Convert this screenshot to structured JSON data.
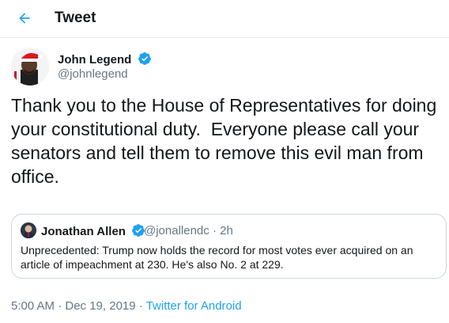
{
  "header": {
    "title": "Tweet",
    "accent_color": "#1da1f2"
  },
  "tweet": {
    "author_name": "John Legend",
    "author_handle": "@johnlegend",
    "verified": true,
    "text": "Thank you to the House of Representatives for doing\nyour constitutional duty.  Everyone please call your\nsenators and tell them to remove this evil man from\noffice.",
    "timestamp": "5:00 AM · Dec 19, 2019",
    "separator": "·",
    "source": "Twitter for Android"
  },
  "quote": {
    "author_name": "Jonathan Allen",
    "verified": true,
    "author_handle": "@jonallendc",
    "separator": "·",
    "time": "2h",
    "text": "Unprecedented: Trump now holds the record for most votes ever acquired on an article of impeachment at 230. He's also No. 2 at 229."
  },
  "icons": {
    "back": "arrow-left-icon",
    "verified": "verified-badge-icon"
  }
}
